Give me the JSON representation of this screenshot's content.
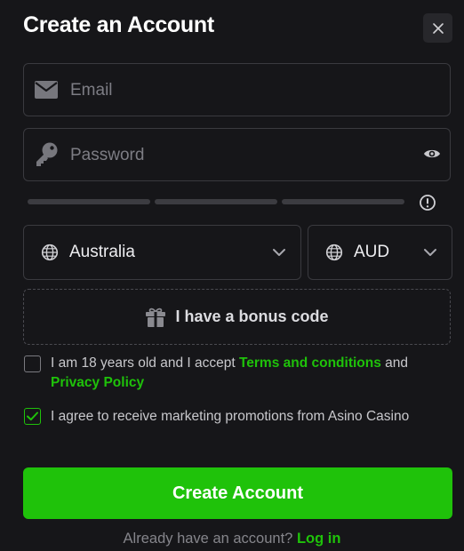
{
  "modal": {
    "title": "Create an Account"
  },
  "form": {
    "email": {
      "placeholder": "Email",
      "value": "",
      "icon": "envelope-icon"
    },
    "password": {
      "placeholder": "Password",
      "value": "",
      "icon": "key-icon",
      "toggle_icon": "eye-icon"
    },
    "password_strength": {
      "segments": 3,
      "filled": 0,
      "info_icon": "info-icon"
    },
    "country": {
      "value": "Australia",
      "icon": "globe-icon"
    },
    "currency": {
      "value": "AUD",
      "icon": "globe-icon"
    },
    "bonus": {
      "label": "I have a bonus code",
      "icon": "gift-icon"
    },
    "age_terms": {
      "checked": false,
      "text_before": "I am 18 years old and I accept ",
      "terms_link": "Terms and conditions",
      "text_and": " and",
      "privacy_link": "Privacy Policy"
    },
    "marketing": {
      "checked": true,
      "text": "I agree to receive marketing promotions from Asino Casino"
    },
    "submit_label": "Create Account"
  },
  "footer": {
    "text": "Already have an account?",
    "login_link": "Log in"
  },
  "colors": {
    "accent": "#1fc20a",
    "background": "#161619",
    "border": "#3a3a3f",
    "muted_text": "#7d7d84"
  }
}
